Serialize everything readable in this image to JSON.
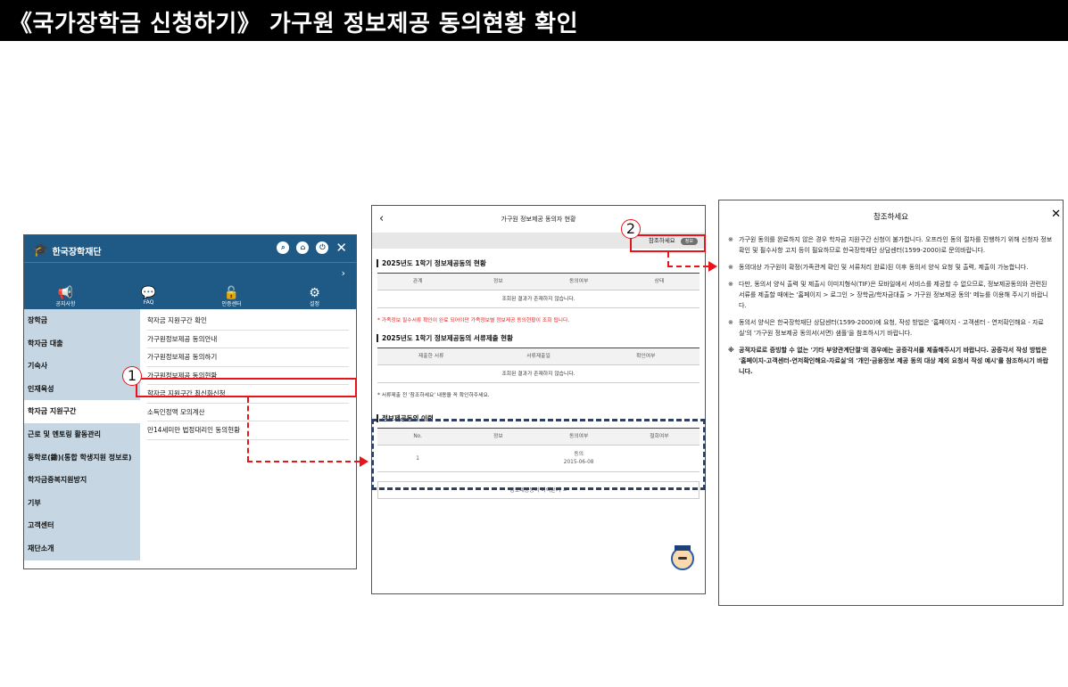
{
  "banner_title": "《국가장학금 신청하기》 가구원 정보제공 동의현황 확인",
  "panel1": {
    "logo_small": "한국장학재단",
    "logo_text": "한국장학재단",
    "nav": [
      {
        "icon": "speaker-icon",
        "label": "공지사항"
      },
      {
        "icon": "chat-icon",
        "label": "FAQ"
      },
      {
        "icon": "lock-icon",
        "label": "인증센터"
      },
      {
        "icon": "gear-icon",
        "label": "설정"
      }
    ],
    "menu": [
      "장학금",
      "학자금 대출",
      "기숙사",
      "인재육성",
      "학자금 지원구간",
      "근로 및 멘토링 활동관리",
      "동학로(鋤)(통합 학생지원 정보로)",
      "학자금중복지원방지",
      "기부",
      "고객센터",
      "재단소개"
    ],
    "submenu": [
      "학자금 지원구간 확인",
      "가구원정보제공 동의안내",
      "가구원정보제공 동의하기",
      "가구원정보제공 동의현황",
      "학자금 지원구간 최신화신청",
      "소득인정액 모의계산",
      "만14세미만 법정대리인 동의현황"
    ]
  },
  "panel2": {
    "title": "가구원 정보제공 동의자 현황",
    "ref_label": "참조하세요",
    "ref_badge": "정보",
    "sec1_title": "2025년도 1학기 정보제공동의 현황",
    "sec1_headers": [
      "관계",
      "정보",
      "동의여부",
      "상태"
    ],
    "sec1_empty": "조회된 결과가 존재하지 않습니다.",
    "sec1_note": "* 가족정보 필수서류 확인이 완료 되어야만 가족정보별 정보제공 동의현황이 조회 됩니다.",
    "sec2_title": "2025년도 1학기 정보제공동의 서류제출 현황",
    "sec2_headers": [
      "제출한 서류",
      "서류제출일",
      "확인여부"
    ],
    "sec2_empty": "조회된 결과가 존재하지 않습니다.",
    "sec2_note": "* 서류제출 전 '참조하세요' 내용을 꼭 확인하주세요.",
    "sec3_title": "정보제공동의 이력",
    "sec3_headers": [
      "No.",
      "정보",
      "동의여부",
      "철회여부"
    ],
    "sec3_rows": [
      {
        "no": "1",
        "info": "",
        "agree": "동의",
        "date": "2015-06-08",
        "withdraw": ""
      }
    ],
    "close_button": "정보제공동의 이력닫기 ㅅ"
  },
  "panel3": {
    "title": "참조하세요",
    "items": [
      "가구원 동의를 완료하지 않은 경우 학자금 지원구간 신청이 불가합니다. 오프라인 동의 절차를 진행하기 위해 신청자 정보확인 및 필수사항 고지 등이 필요하므로 한국장학재단 상담센터(1599-2000)로 문의바랍니다.",
      "동의대상 가구원이 확정(가족관계 확인 및 서류처리 완료)된 이후 동의서 양식 요청 및 출력, 제출이 가능합니다.",
      "다만, 동의서 양식 출력 및 제출시 이미지형식(TIF)은 모바일에서 서비스를 제공할 수 없으므로, 정보제공동의와 관련된 서류를 제출할 때에는 '홈페이지 > 로그인 > 장학금/학자금대출 > 가구원 정보제공 동의' 메뉴를 이용해 주시기 바랍니다.",
      "동의서 양식은 한국장학재단 상담센터(1599-2000)에 요청, 작성 방법은 '홈페이지 - 고객센터 - 연저확인해요 - 자료실'의 '가구원 정보제공 동의서(서면) 샘플'을 참조하시기 바랍니다.",
      "공적자료로 증빙할 수 없는 '기타 부양관계단절'의 경우에는 공증각서를 제출해주시기 바랍니다. 공증각서 작성 방법은 '홈페이지-고객센터-연저확인해요-자료실'의 '개인·금융정보 제공 동의 대상 제외 요청서 작성 예시'를 참조하시기 바랍니다."
    ],
    "marker": "※"
  },
  "annotations": {
    "step1": "1",
    "step2": "2"
  }
}
